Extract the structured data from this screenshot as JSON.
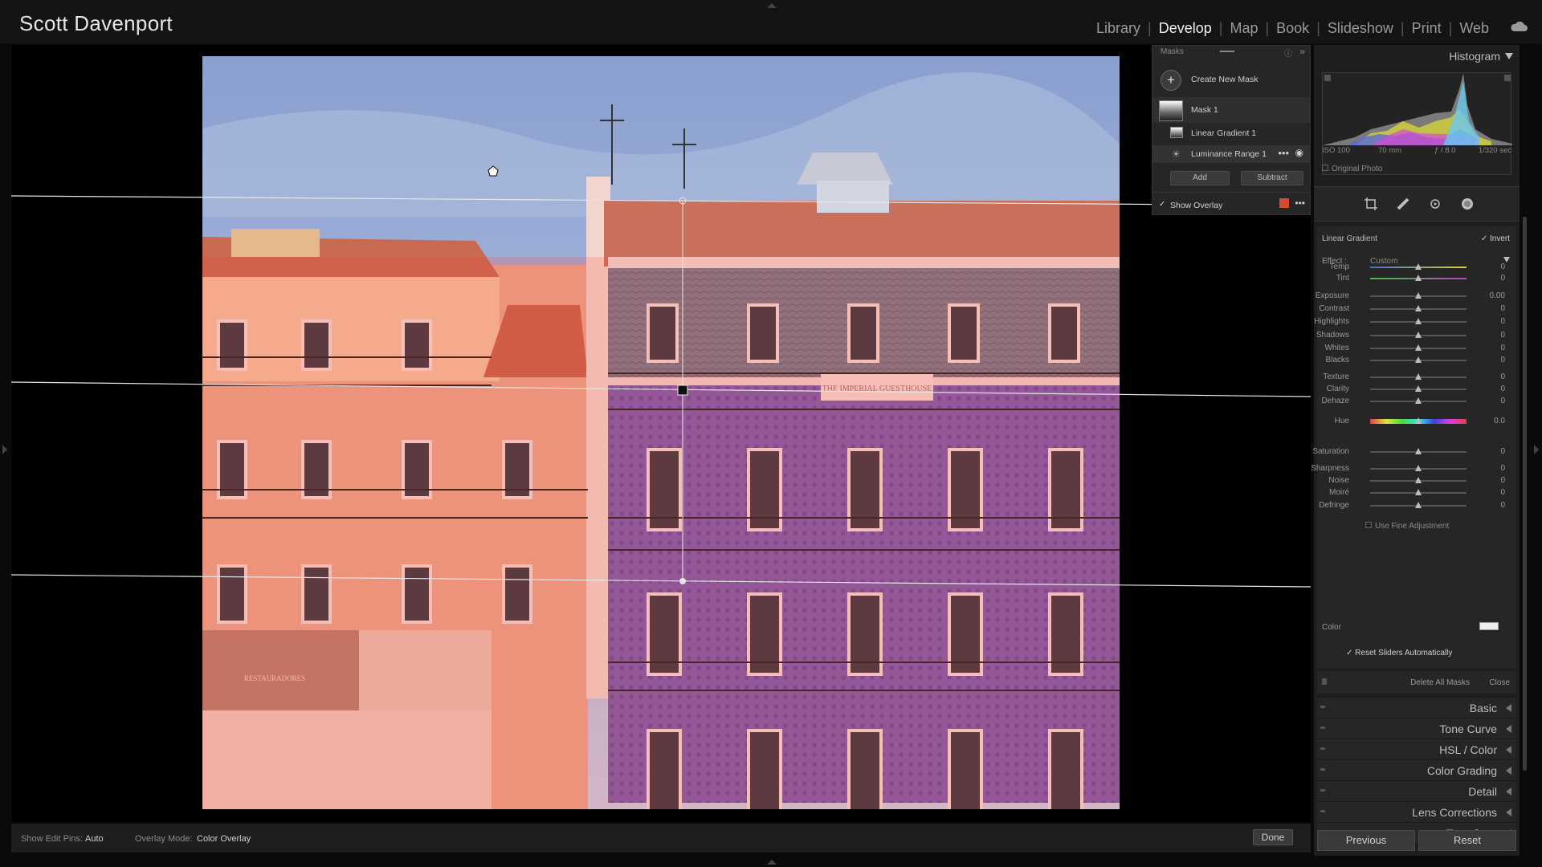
{
  "identity_plate": "Scott Davenport",
  "modules": [
    "Library",
    "Develop",
    "Map",
    "Book",
    "Slideshow",
    "Print",
    "Web"
  ],
  "active_module": "Develop",
  "accent": {
    "overlay_color": "#ff3f2a",
    "panel_bg": "#262626"
  },
  "photo": {
    "banner_text": "THE IMPERIAL GUESTHOUSE",
    "sign_text": "RESTAURADORES"
  },
  "toolbar": {
    "edit_pins_label": "Show Edit Pins:",
    "edit_pins_value": "Auto",
    "overlay_mode_label": "Overlay Mode:",
    "overlay_mode_value": "Color Overlay",
    "done_label": "Done"
  },
  "masks_panel": {
    "title": "Masks",
    "create_new_mask": "Create New Mask",
    "mask_name": "Mask 1",
    "components": [
      "Linear Gradient 1",
      "Luminance Range 1"
    ],
    "add_label": "Add",
    "subtract_label": "Subtract",
    "show_overlay_label": "Show Overlay",
    "show_overlay_checked": true
  },
  "histogram": {
    "title": "Histogram",
    "iso": "ISO 100",
    "focal": "70 mm",
    "aperture": "ƒ / 8.0",
    "shutter": "1/320 sec",
    "original_photo_label": "Original Photo"
  },
  "mask_settings": {
    "mask_type": "Linear Gradient",
    "invert_label": "Invert",
    "invert_checked": true,
    "effect_label": "Effect :",
    "effect_value": "Custom",
    "sliders": [
      {
        "label": "Temp",
        "value": "0",
        "pos": 0.5
      },
      {
        "label": "Tint",
        "value": "0",
        "pos": 0.5
      },
      {
        "label": "Exposure",
        "value": "0.00",
        "pos": 0.5
      },
      {
        "label": "Contrast",
        "value": "0",
        "pos": 0.5
      },
      {
        "label": "Highlights",
        "value": "0",
        "pos": 0.5
      },
      {
        "label": "Shadows",
        "value": "0",
        "pos": 0.5
      },
      {
        "label": "Whites",
        "value": "0",
        "pos": 0.5
      },
      {
        "label": "Blacks",
        "value": "0",
        "pos": 0.5
      },
      {
        "label": "Texture",
        "value": "0",
        "pos": 0.5
      },
      {
        "label": "Clarity",
        "value": "0",
        "pos": 0.5
      },
      {
        "label": "Dehaze",
        "value": "0",
        "pos": 0.5
      },
      {
        "label": "Hue",
        "value": "0.0",
        "pos": 0.5
      },
      {
        "label": "Saturation",
        "value": "0",
        "pos": 0.5
      },
      {
        "label": "Sharpness",
        "value": "0",
        "pos": 0.5
      },
      {
        "label": "Noise",
        "value": "0",
        "pos": 0.5
      },
      {
        "label": "Moiré",
        "value": "0",
        "pos": 0.5
      },
      {
        "label": "Defringe",
        "value": "0",
        "pos": 0.5
      }
    ],
    "use_fine_adjustment": "Use Fine Adjustment",
    "color_label": "Color",
    "reset_sliders_label": "Reset Sliders Automatically",
    "delete_all_masks": "Delete All Masks",
    "close_label": "Close"
  },
  "panels": [
    "Basic",
    "Tone Curve",
    "HSL / Color",
    "Color Grading",
    "Detail",
    "Lens Corrections",
    "Transform"
  ],
  "footer": {
    "previous_label": "Previous",
    "reset_label": "Reset"
  }
}
